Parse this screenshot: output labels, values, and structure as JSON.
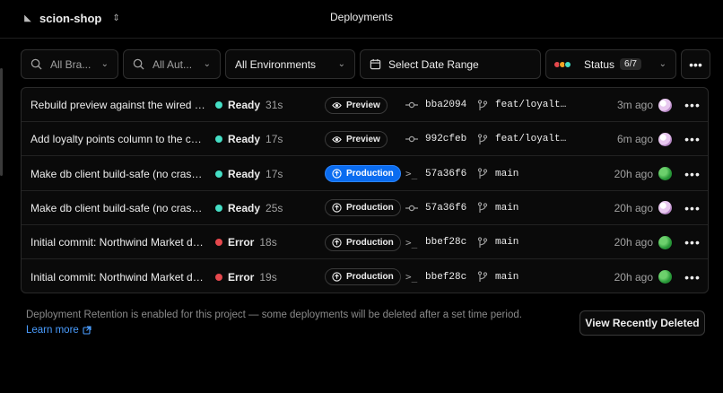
{
  "header": {
    "project_name": "scion-shop",
    "page_title": "Deployments"
  },
  "filters": {
    "branch_placeholder": "All Bra...",
    "author_placeholder": "All Aut...",
    "environment": "All Environments",
    "date_range": "Select Date Range",
    "status_label": "Status",
    "status_count": "6/7",
    "status_colors": [
      "#e5484d",
      "#f5a524",
      "#45dec5"
    ]
  },
  "deployments": [
    {
      "title": "Rebuild preview against the wired bran...",
      "status": "Ready",
      "duration": "31s",
      "status_color": "#45dec5",
      "environment": "Preview",
      "env_icon": "eye-icon",
      "env_active": false,
      "commit_icon": "commit-icon",
      "sha": "bba2094",
      "branch": "feat/loyalty...",
      "age": "3m ago",
      "avatar": "pink"
    },
    {
      "title": "Add loyalty points column to the customers table",
      "status": "Ready",
      "duration": "17s",
      "status_color": "#45dec5",
      "environment": "Preview",
      "env_icon": "eye-icon",
      "env_active": false,
      "commit_icon": "commit-icon",
      "sha": "992cfeb",
      "branch": "feat/loyalty...",
      "age": "6m ago",
      "avatar": "pink"
    },
    {
      "title": "Make db client build-safe (no crash when env missing)",
      "status": "Ready",
      "duration": "17s",
      "status_color": "#45dec5",
      "environment": "Production",
      "env_icon": "arrow-up-circle-icon",
      "env_active": true,
      "commit_icon": "terminal-icon",
      "sha": "57a36f6",
      "branch": "main",
      "age": "20h ago",
      "avatar": "green"
    },
    {
      "title": "Make db client build-safe (no crash when env missing)",
      "status": "Ready",
      "duration": "25s",
      "status_color": "#45dec5",
      "environment": "Production",
      "env_icon": "arrow-up-circle-icon",
      "env_active": false,
      "commit_icon": "commit-icon",
      "sha": "57a36f6",
      "branch": "main",
      "age": "20h ago",
      "avatar": "pink"
    },
    {
      "title": "Initial commit: Northwind Market demo",
      "status": "Error",
      "duration": "18s",
      "status_color": "#e5484d",
      "environment": "Production",
      "env_icon": "arrow-up-circle-icon",
      "env_active": false,
      "commit_icon": "terminal-icon",
      "sha": "bbef28c",
      "branch": "main",
      "age": "20h ago",
      "avatar": "green"
    },
    {
      "title": "Initial commit: Northwind Market demo",
      "status": "Error",
      "duration": "19s",
      "status_color": "#e5484d",
      "environment": "Production",
      "env_icon": "arrow-up-circle-icon",
      "env_active": false,
      "commit_icon": "terminal-icon",
      "sha": "bbef28c",
      "branch": "main",
      "age": "20h ago",
      "avatar": "green"
    }
  ],
  "footer": {
    "retention_note": "Deployment Retention is enabled for this project — some deployments will be deleted after a set time period.",
    "learn_more": "Learn more",
    "view_deleted": "View Recently Deleted"
  }
}
